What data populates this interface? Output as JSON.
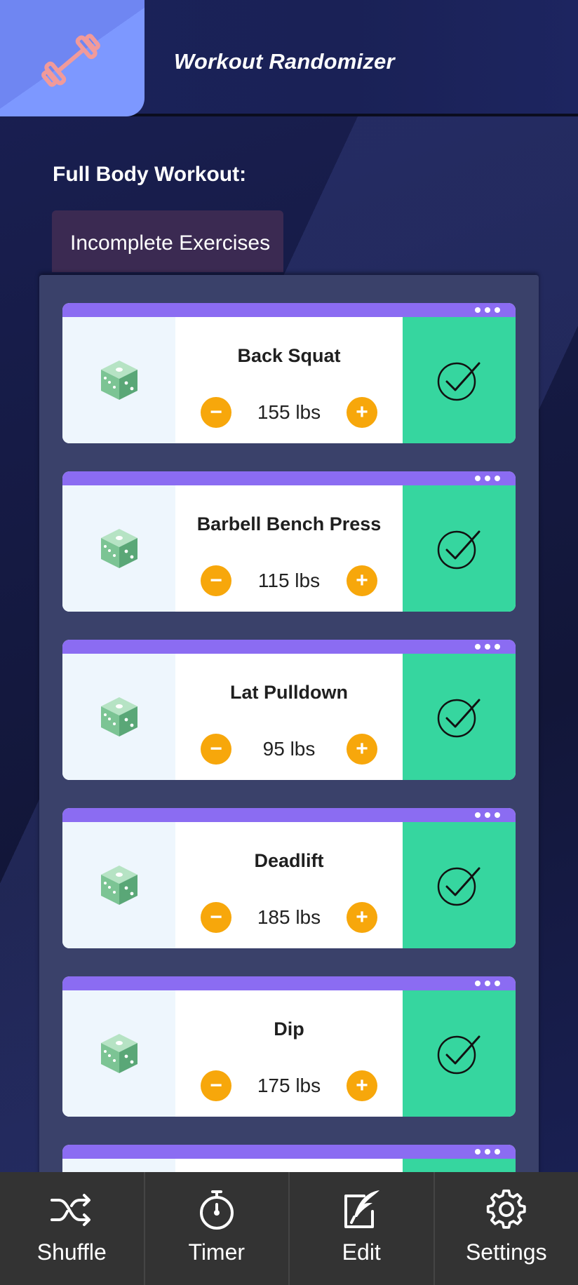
{
  "app": {
    "title": "Workout Randomizer",
    "logo_icon": "dumbbell-icon"
  },
  "section": {
    "title": "Full Body Workout:",
    "tab_label": "Incomplete Exercises"
  },
  "exercises": [
    {
      "name": "Back Squat",
      "weight": "155 lbs"
    },
    {
      "name": "Barbell Bench Press",
      "weight": "115 lbs"
    },
    {
      "name": "Lat Pulldown",
      "weight": "95 lbs"
    },
    {
      "name": "Deadlift",
      "weight": "185 lbs"
    },
    {
      "name": "Dip",
      "weight": "175 lbs"
    }
  ],
  "nav": [
    {
      "label": "Shuffle",
      "icon": "shuffle-icon"
    },
    {
      "label": "Timer",
      "icon": "stopwatch-icon"
    },
    {
      "label": "Edit",
      "icon": "edit-feather-icon"
    },
    {
      "label": "Settings",
      "icon": "gear-icon"
    }
  ],
  "colors": {
    "accent_purple": "#8b6cf2",
    "done_green": "#36d69f",
    "stepper_orange": "#f7a70b",
    "nav_bg": "#333333"
  }
}
